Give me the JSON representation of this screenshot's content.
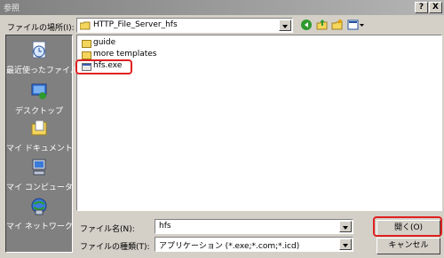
{
  "window": {
    "title": "参照",
    "help_label": "?",
    "close_label": "X"
  },
  "location": {
    "label": "ファイルの場所(I):",
    "value": "HTTP_File_Server_hfs"
  },
  "places": [
    {
      "label": "最近使ったファイル",
      "icon": "recent-documents-icon"
    },
    {
      "label": "デスクトップ",
      "icon": "desktop-icon"
    },
    {
      "label": "マイ ドキュメント",
      "icon": "my-documents-icon"
    },
    {
      "label": "マイ コンピュータ",
      "icon": "my-computer-icon"
    },
    {
      "label": "マイ ネットワーク",
      "icon": "my-network-icon"
    }
  ],
  "files": [
    {
      "name": "guide",
      "type": "folder"
    },
    {
      "name": "more templates",
      "type": "folder"
    },
    {
      "name": "hfs.exe",
      "type": "exe"
    }
  ],
  "filename": {
    "label": "ファイル名(N):",
    "value": "hfs"
  },
  "filetype": {
    "label": "ファイルの種類(T):",
    "value": "アプリケーション (*.exe;*.com;*.icd)"
  },
  "buttons": {
    "open": "開く(O)",
    "cancel": "キャンセル"
  },
  "colors": {
    "highlight": "#e02020",
    "titlebar": "#808080",
    "places_bg": "#808080"
  }
}
